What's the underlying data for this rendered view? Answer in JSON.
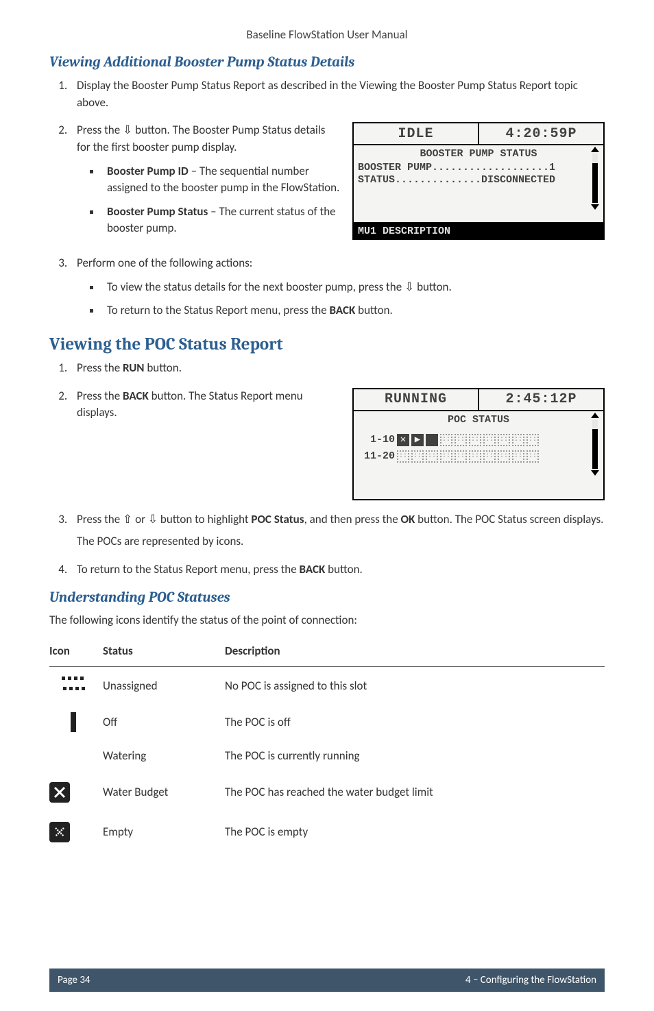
{
  "runningHead": "Baseline FlowStation User Manual",
  "sec1": {
    "title": "Viewing Additional Booster Pump Status Details",
    "steps": {
      "s1": "Display the Booster Pump Status Report as described in the Viewing the Booster Pump Status Report topic above.",
      "s2_pre": "Press the ",
      "s2_arrow": "⇩",
      "s2_post": " button. The Booster Pump Status details for the first booster pump display.",
      "b1a_label": "Booster Pump ID",
      "b1a_text": " – The sequential number assigned to the booster pump in the FlowStation.",
      "b1b_label": "Booster Pump Status",
      "b1b_text": " – The current status of the booster pump.",
      "s3": "Perform one of the following actions:",
      "b2a_pre": "To view the status details for the next booster pump, press the ",
      "b2a_arrow": "⇩",
      "b2a_post": " button.",
      "b2b_pre": "To return to the Status Report menu, press the ",
      "b2b_btn": "BACK",
      "b2b_post": " button."
    },
    "lcd": {
      "left": "IDLE",
      "right": "4:20:59P",
      "sub": "BOOSTER PUMP STATUS",
      "row1": "BOOSTER PUMP...................1",
      "row2": "STATUS..............DISCONNECTED",
      "foot": "MU1 DESCRIPTION"
    }
  },
  "sec2": {
    "title": "Viewing the POC Status Report",
    "s1_pre": "Press the ",
    "s1_btn": "RUN",
    "s1_post": " button.",
    "s2_pre": "Press the ",
    "s2_btn": "BACK",
    "s2_post": " button. The Status Report menu displays.",
    "s3_pre": "Press the ",
    "s3_up": "⇧",
    "s3_or": " or ",
    "s3_down": "⇩",
    "s3_mid": " button to highlight ",
    "s3_poc": "POC Status",
    "s3_mid2": ", and then press the ",
    "s3_ok": "OK",
    "s3_post": " button. The POC Status screen displays.",
    "s3_note": "The POCs are represented by icons.",
    "s4_pre": "To return to the Status Report menu, press the ",
    "s4_btn": "BACK",
    "s4_post": " button.",
    "lcd": {
      "left": "RUNNING",
      "right": "2:45:12P",
      "sub": "POC STATUS",
      "row1lab": "1-10",
      "row2lab": "11-20"
    }
  },
  "sec3": {
    "title": "Understanding POC Statuses",
    "intro": "The following icons identify the status of the point of connection:",
    "headers": {
      "icon": "Icon",
      "status": "Status",
      "desc": "Description"
    },
    "rows": [
      {
        "status": "Unassigned",
        "desc": "No POC is assigned to this slot"
      },
      {
        "status": "Off",
        "desc": "The POC is off"
      },
      {
        "status": "Watering",
        "desc": "The POC is currently running"
      },
      {
        "status": "Water Budget",
        "desc": "The POC has reached the water budget limit"
      },
      {
        "status": "Empty",
        "desc": "The POC is empty"
      }
    ]
  },
  "footer": {
    "left": "Page 34",
    "right": "4 – Configuring the FlowStation"
  }
}
